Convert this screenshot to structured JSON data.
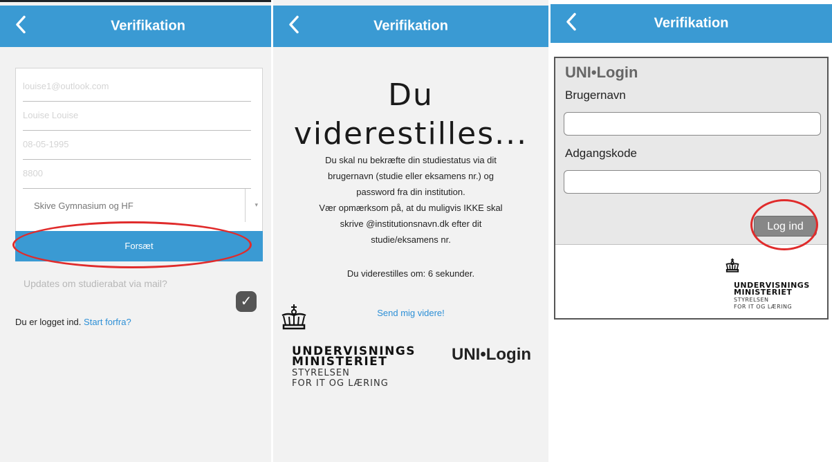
{
  "navbar": {
    "title": "Verifikation",
    "back_icon": "chevron-left-icon"
  },
  "panel1": {
    "fields": [
      {
        "placeholder": "louise1@outlook.com"
      },
      {
        "placeholder": "Louise Louise"
      },
      {
        "placeholder": "08-05-1995"
      },
      {
        "placeholder": "8800"
      }
    ],
    "school_select": {
      "value": "Skive Gymnasium og HF",
      "arrow": "▾"
    },
    "continue_label": "Forsæt",
    "updates_label": "Updates om studierabat via mail?",
    "updates_checked": true,
    "logged_in_text": "Du er logget ind.",
    "restart_link": "Start forfra?",
    "highlight_color": "#e02b2b",
    "accent_color": "#3a9ad3"
  },
  "panel2": {
    "heading_line1": "Du",
    "heading_line2": "viderestilles...",
    "instructions": [
      "Du skal nu bekræfte din studiestatus via dit",
      "brugernavn (studie eller eksamens nr.) og",
      "password fra din institution.",
      "Vær opmærksom på, at du muligvis IKKE skal",
      "skrive @institutionsnavn.dk efter dit",
      "studie/eksamens nr."
    ],
    "countdown_text": "Du viderestilles om: 6 sekunder.",
    "send_link": "Send mig videre!",
    "ministry_name_1": "UNDERVISNINGS",
    "ministry_name_2": "MINISTERIET",
    "agency_line_1": "STYRELSEN",
    "agency_line_2": "FOR IT OG LÆRING",
    "unilogin_logo": "UNI•Login"
  },
  "panel3": {
    "unilogin_logo": "UNI•Login",
    "username_label": "Brugernavn",
    "username_value": "",
    "password_label": "Adgangskode",
    "password_value": "",
    "login_button": "Log ind",
    "ministry_name_1": "UNDERVISNINGS",
    "ministry_name_2": "MINISTERIET",
    "agency_line_1": "STYRELSEN",
    "agency_line_2": "FOR IT OG LÆRING"
  }
}
